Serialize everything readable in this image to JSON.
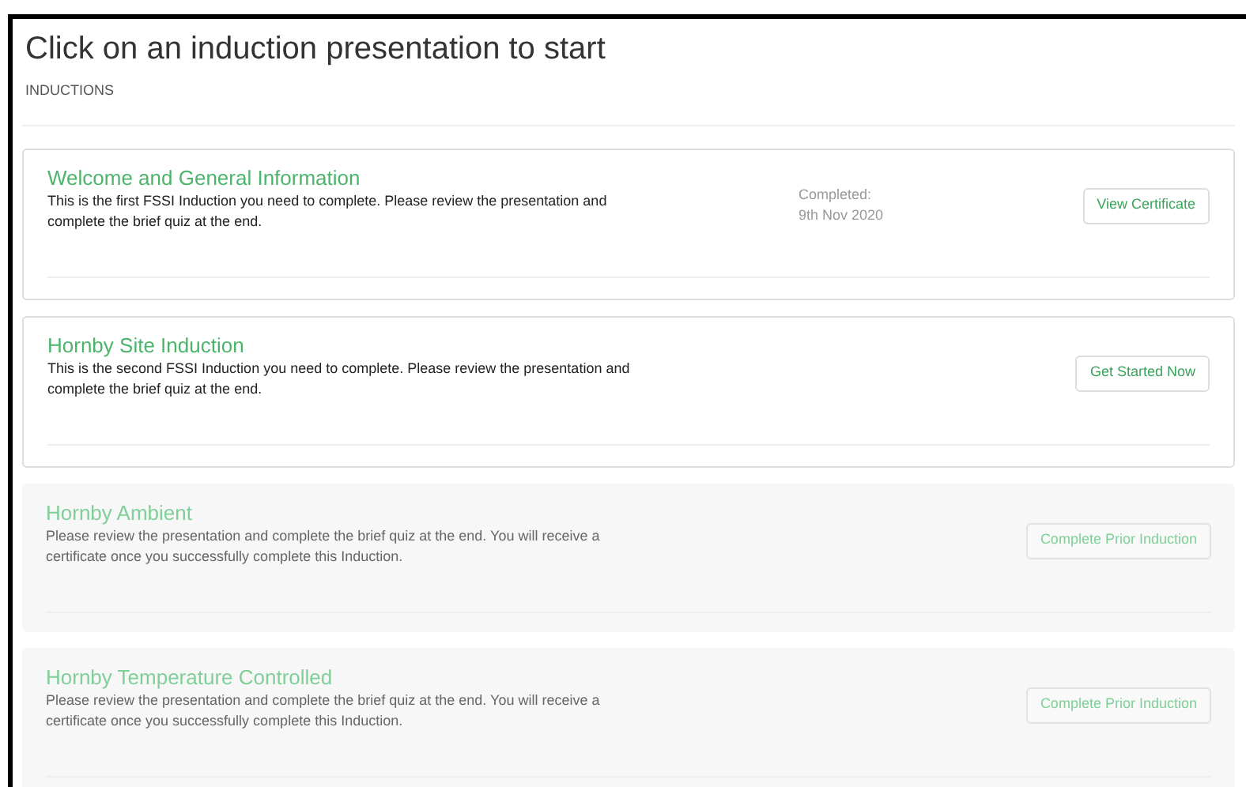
{
  "title": "Click on an induction presentation to start",
  "section_label": "INDUCTIONS",
  "inductions": [
    {
      "title": "Welcome and General Information",
      "description": "This is the first FSSI Induction you need to complete. Please review the presentation and complete the brief quiz at the end.",
      "status_label": "Completed:",
      "status_date": "9th Nov 2020",
      "button": "View Certificate",
      "locked": false
    },
    {
      "title": "Hornby Site Induction",
      "description": "This is the second FSSI Induction you need to complete. Please review the presentation and complete the brief quiz at the end.",
      "button": "Get Started Now",
      "locked": false
    },
    {
      "title": "Hornby Ambient",
      "description": "Please review the presentation and complete the brief quiz at the end. You will receive a certificate once you successfully complete this Induction.",
      "button": "Complete Prior Induction",
      "locked": true
    },
    {
      "title": "Hornby Temperature Controlled",
      "description": "Please review the presentation and complete the brief quiz at the end. You will receive a certificate once you successfully complete this Induction.",
      "button": "Complete Prior Induction",
      "locked": true
    }
  ]
}
